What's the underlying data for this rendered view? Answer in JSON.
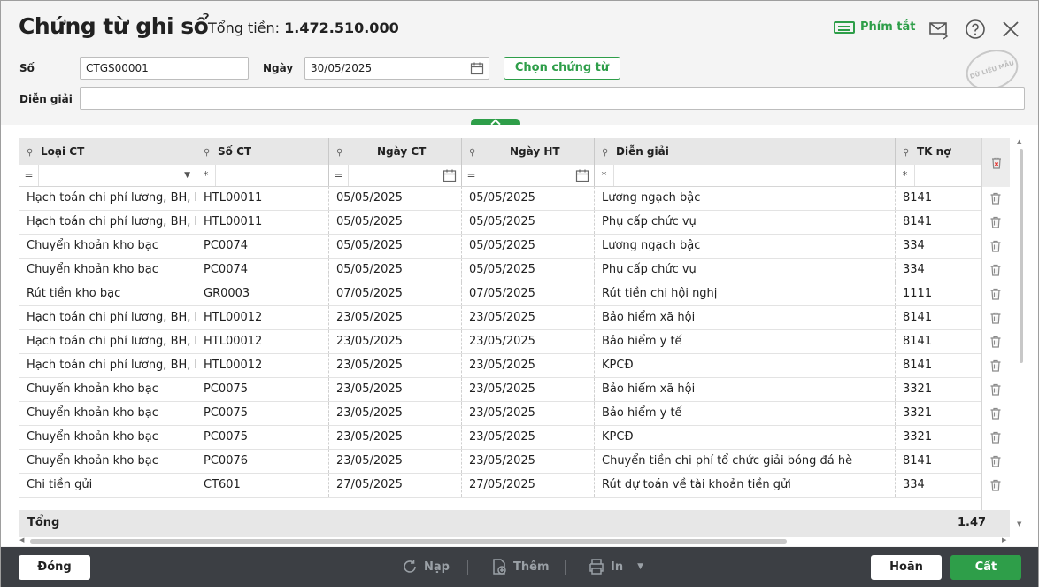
{
  "header": {
    "title": "Chứng từ ghi sổ",
    "total_label": "Tổng tiền:",
    "total_value": "1.472.510.000",
    "shortcut_label": "Phím tắt",
    "stamp_text": "DỮ LIỆU MẪU"
  },
  "form": {
    "so_label": "Số",
    "so_value": "CTGS00001",
    "ngay_label": "Ngày",
    "ngay_value": "30/05/2025",
    "choose_button": "Chọn chứng từ",
    "dien_giai_label": "Diễn giải",
    "dien_giai_value": ""
  },
  "grid": {
    "columns": [
      "Loại CT",
      "Số CT",
      "Ngày CT",
      "Ngày HT",
      "Diễn giải",
      "TK nợ"
    ],
    "filters": [
      "=",
      "*",
      "=",
      "=",
      "*",
      "*"
    ],
    "rows": [
      [
        "Hạch toán chi phí lương, BH, KPCĐ",
        "HTL00011",
        "05/05/2025",
        "05/05/2025",
        "Lương ngạch bậc",
        "8141"
      ],
      [
        "Hạch toán chi phí lương, BH, KPCĐ",
        "HTL00011",
        "05/05/2025",
        "05/05/2025",
        "Phụ cấp chức vụ",
        "8141"
      ],
      [
        "Chuyển khoản kho bạc",
        "PC0074",
        "05/05/2025",
        "05/05/2025",
        "Lương ngạch bậc",
        "334"
      ],
      [
        "Chuyển khoản kho bạc",
        "PC0074",
        "05/05/2025",
        "05/05/2025",
        "Phụ cấp chức vụ",
        "334"
      ],
      [
        "Rút tiền kho bạc",
        "GR0003",
        "07/05/2025",
        "07/05/2025",
        "Rút tiền chi hội nghị",
        "1111"
      ],
      [
        "Hạch toán chi phí lương, BH, KPCĐ",
        "HTL00012",
        "23/05/2025",
        "23/05/2025",
        "Bảo hiểm xã hội",
        "8141"
      ],
      [
        "Hạch toán chi phí lương, BH, KPCĐ",
        "HTL00012",
        "23/05/2025",
        "23/05/2025",
        "Bảo hiểm y tế",
        "8141"
      ],
      [
        "Hạch toán chi phí lương, BH, KPCĐ",
        "HTL00012",
        "23/05/2025",
        "23/05/2025",
        "KPCĐ",
        "8141"
      ],
      [
        "Chuyển khoản kho bạc",
        "PC0075",
        "23/05/2025",
        "23/05/2025",
        "Bảo hiểm xã hội",
        "3321"
      ],
      [
        "Chuyển khoản kho bạc",
        "PC0075",
        "23/05/2025",
        "23/05/2025",
        "Bảo hiểm y tế",
        "3321"
      ],
      [
        "Chuyển khoản kho bạc",
        "PC0075",
        "23/05/2025",
        "23/05/2025",
        "KPCĐ",
        "3321"
      ],
      [
        "Chuyển khoản kho bạc",
        "PC0076",
        "23/05/2025",
        "23/05/2025",
        "Chuyển tiền chi phí tổ chức giải bóng đá hè",
        "8141"
      ],
      [
        "Chi tiền gửi",
        "CT601",
        "27/05/2025",
        "27/05/2025",
        "Rút dự toán về tài khoản tiền gửi",
        "334"
      ]
    ],
    "sum_label": "Tổng",
    "sum_value": "1.47"
  },
  "footer": {
    "close": "Đóng",
    "reload": "Nạp",
    "add": "Thêm",
    "print": "In",
    "cancel": "Hoãn",
    "save": "Cất"
  },
  "colors": {
    "accent": "#2e9e49",
    "footer_bg": "#3c3f44",
    "delete_icon_red": "#e53935"
  }
}
